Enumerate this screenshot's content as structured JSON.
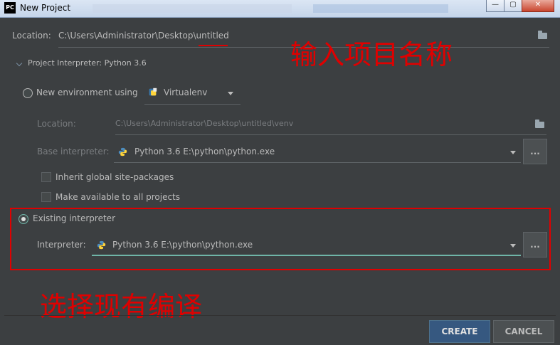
{
  "window": {
    "title": "New Project",
    "app_icon": "PC",
    "minimize": "—",
    "maximize": "▢",
    "close": "✕"
  },
  "location": {
    "label": "Location:",
    "value_prefix": "C:\\Users\\Administrator\\Desktop\\",
    "value_name": "untitled"
  },
  "interpreter_section": {
    "title": "Project Interpreter: Python 3.6"
  },
  "new_env": {
    "label": "New environment using",
    "tool": "Virtualenv",
    "location_label": "Location:",
    "location_value": "C:\\Users\\Administrator\\Desktop\\untitled\\venv",
    "base_label": "Base interpreter:",
    "base_value": "Python 3.6 E:\\python\\python.exe",
    "inherit_label": "Inherit global site-packages",
    "available_label": "Make available to all projects"
  },
  "existing": {
    "label": "Existing interpreter",
    "interpreter_label": "Interpreter:",
    "interpreter_value": "Python 3.6 E:\\python\\python.exe"
  },
  "ellipsis": "...",
  "annotations": {
    "top": "输入项目名称",
    "bottom": "选择现有编译"
  },
  "buttons": {
    "create": "CREATE",
    "cancel": "CANCEL"
  },
  "colors": {
    "background": "#3c3f41",
    "accent": "#365880",
    "annotation": "#e00000",
    "focus": "#6fb5a8"
  }
}
